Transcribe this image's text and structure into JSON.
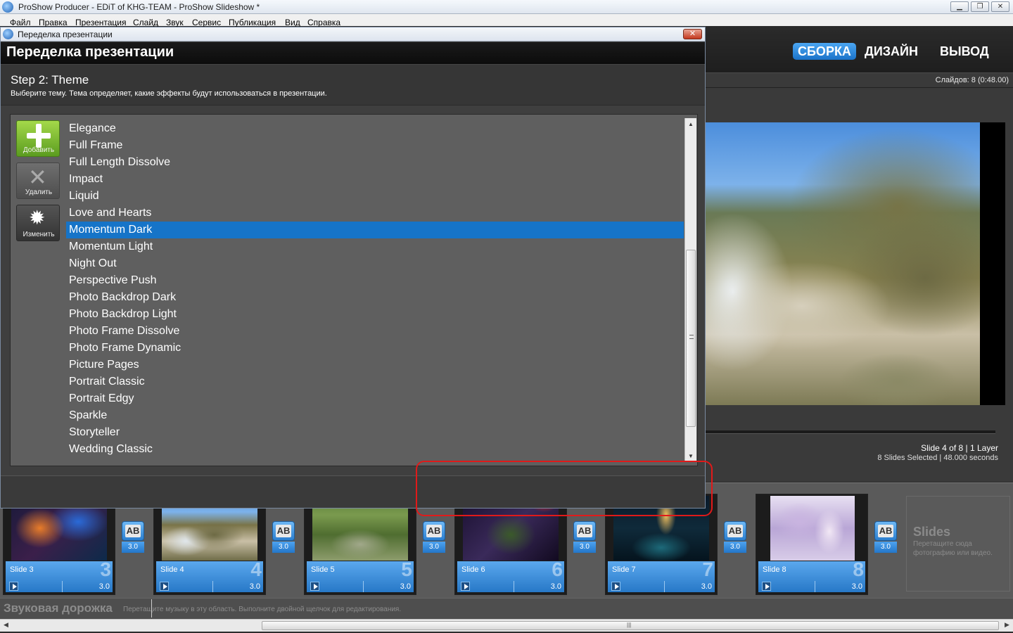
{
  "app": {
    "title": "ProShow Producer - EDiT of KHG-TEAM - ProShow Slideshow *",
    "window_buttons": [
      "▁",
      "❐",
      "✕"
    ]
  },
  "menu": [
    "Файл",
    "Правка",
    "Презентация",
    "Слайд",
    "Звук",
    "Сервис",
    "Публикация",
    "Вид",
    "Справка"
  ],
  "nav": {
    "tabs": [
      "СБОРКА",
      "ДИЗАЙН",
      "ВЫВОД"
    ],
    "active": "СБОРКА",
    "accent": "#1b73c9"
  },
  "slide_count": "Слайдов: 8 (0:48.00)",
  "preview": {
    "slide_info": "Slide 4 of 8  |  1 Layer",
    "selection_info": "8 Slides Selected  |  48.000 seconds"
  },
  "dialog": {
    "window_title": "Переделка презентации",
    "header": "Переделка презентации",
    "close": "✕",
    "step_title": "Step 2: Theme",
    "step_description": "Выберите тему. Тема определяет, какие эффекты будут использоваться в презентации.",
    "tools": {
      "add": "Добавить",
      "delete": "Удалить",
      "edit": "Изменить",
      "gear_glyph": "✹",
      "x_glyph": "✕"
    },
    "themes": [
      "Elegance",
      "Full Frame",
      "Full Length Dissolve",
      "Impact",
      "Liquid",
      "Love and Hearts",
      "Momentum Dark",
      "Momentum Light",
      "Night Out",
      "Perspective Push",
      "Photo Backdrop Dark",
      "Photo Backdrop Light",
      "Photo Frame Dissolve",
      "Photo Frame Dynamic",
      "Picture Pages",
      "Portrait Classic",
      "Portrait Edgy",
      "Sparkle",
      "Storyteller",
      "Wedding Classic"
    ],
    "selected_theme": "Momentum Dark",
    "selection_color": "#1674c8"
  },
  "filmstrip": {
    "slides": [
      {
        "name": "Slide 3",
        "number": "3",
        "duration": "3.0",
        "transition": "3.0"
      },
      {
        "name": "Slide 4",
        "number": "4",
        "duration": "3.0",
        "transition": "3.0"
      },
      {
        "name": "Slide 5",
        "number": "5",
        "duration": "3.0",
        "transition": "3.0"
      },
      {
        "name": "Slide 6",
        "number": "6",
        "duration": "3.0",
        "transition": "3.0"
      },
      {
        "name": "Slide 7",
        "number": "7",
        "duration": "3.0",
        "transition": "3.0"
      },
      {
        "name": "Slide 8",
        "number": "8",
        "duration": "3.0",
        "transition": "3.0"
      }
    ],
    "transition_label": "AB",
    "drop_title": "Slides",
    "drop_hint": "Перетащите сюда фотографию или видео."
  },
  "soundtrack": {
    "title": "Звуковая дорожка",
    "hint": "Перетащите музыку в эту область. Выполните двойной щелчок для редактирования."
  },
  "scrollbar": {
    "left": "◀",
    "right": "▶",
    "up": "▲",
    "down": "▼",
    "grip": "|||"
  }
}
